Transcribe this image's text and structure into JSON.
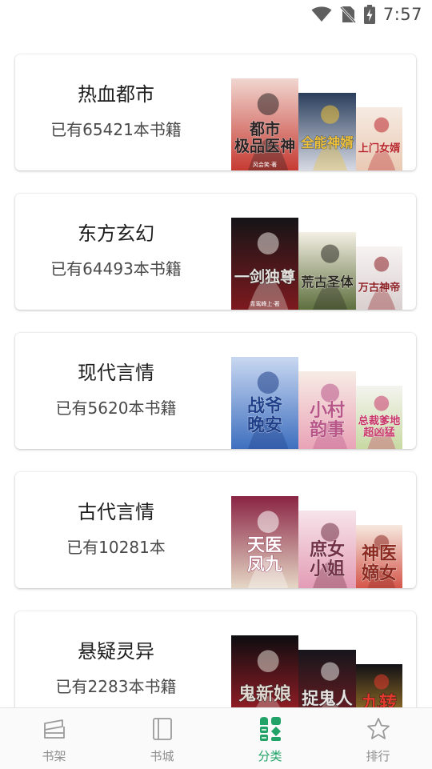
{
  "status_bar": {
    "time": "7:57"
  },
  "categories": [
    {
      "title": "热血都市",
      "count": "已有65421本书籍",
      "covers": [
        {
          "lines": [
            "都市",
            "极品医神"
          ],
          "tag": "风会笑·著",
          "palette": [
            "#f0d6cf",
            "#c63a32",
            "#2b2224"
          ]
        },
        {
          "lines": [
            "全能神婿"
          ],
          "tag": "",
          "palette": [
            "#2a3e5c",
            "#d7dae4",
            "#efc23a"
          ]
        },
        {
          "lines": [
            "上门女婿"
          ],
          "tag": "",
          "palette": [
            "#f6ebe2",
            "#e9c9b3",
            "#b9272b"
          ]
        }
      ]
    },
    {
      "title": "东方玄幻",
      "count": "已有64493本书籍",
      "covers": [
        {
          "lines": [
            "一剑独尊"
          ],
          "tag": "青鸾峰上·著",
          "palette": [
            "#151417",
            "#7d1a1e",
            "#e7e2dd"
          ]
        },
        {
          "lines": [
            "荒古圣体"
          ],
          "tag": "",
          "palette": [
            "#f4f0e4",
            "#5e6f3e",
            "#2a2a23"
          ]
        },
        {
          "lines": [
            "万古神帝"
          ],
          "tag": "",
          "palette": [
            "#f7f3f2",
            "#d9cfcf",
            "#8b1e23"
          ]
        }
      ]
    },
    {
      "title": "现代言情",
      "count": "已有5620本书籍",
      "covers": [
        {
          "lines": [
            "战爷",
            "晚安"
          ],
          "tag": "",
          "palette": [
            "#c9d8f1",
            "#3e6fbf",
            "#1f3f88"
          ]
        },
        {
          "lines": [
            "小村",
            "韵事"
          ],
          "tag": "",
          "palette": [
            "#f7ece5",
            "#e9a3b7",
            "#b8568a"
          ]
        },
        {
          "lines": [
            "总裁爹地",
            "超凶猛"
          ],
          "tag": "",
          "palette": [
            "#f4f4ef",
            "#c8d9a3",
            "#c8386a"
          ]
        }
      ]
    },
    {
      "title": "古代言情",
      "count": "已有10281本",
      "covers": [
        {
          "lines": [
            "天医",
            "凤九"
          ],
          "tag": "",
          "palette": [
            "#8a2444",
            "#e5d7c5",
            "#ffffff"
          ]
        },
        {
          "lines": [
            "庶女",
            "小姐"
          ],
          "tag": "",
          "palette": [
            "#f7e4ea",
            "#e39cb5",
            "#703046"
          ]
        },
        {
          "lines": [
            "神医",
            "嫡女"
          ],
          "tag": "",
          "palette": [
            "#f6e9df",
            "#d5554a",
            "#8c2a22"
          ]
        }
      ]
    },
    {
      "title": "悬疑灵异",
      "count": "已有2283本书籍",
      "covers": [
        {
          "lines": [
            "鬼新娘"
          ],
          "tag": "",
          "palette": [
            "#0d0d10",
            "#b1202a",
            "#e1d8d0"
          ]
        },
        {
          "lines": [
            "捉鬼人"
          ],
          "tag": "",
          "palette": [
            "#16161c",
            "#7b1d22",
            "#e8e3e0"
          ]
        },
        {
          "lines": [
            "九转"
          ],
          "tag": "",
          "palette": [
            "#121116",
            "#b7882b",
            "#e33a2c"
          ]
        }
      ]
    }
  ],
  "tabs": [
    {
      "label": "书架",
      "icon": "bookshelf-icon",
      "active": false
    },
    {
      "label": "书城",
      "icon": "bookstore-icon",
      "active": false
    },
    {
      "label": "分类",
      "icon": "category-grid-icon",
      "active": true
    },
    {
      "label": "排行",
      "icon": "star-icon",
      "active": false
    }
  ],
  "colors": {
    "accent": "#21a368",
    "tab_inactive": "#8e8e8e",
    "card_background": "#ffffff",
    "tab_bar_background": "#fafafa"
  }
}
